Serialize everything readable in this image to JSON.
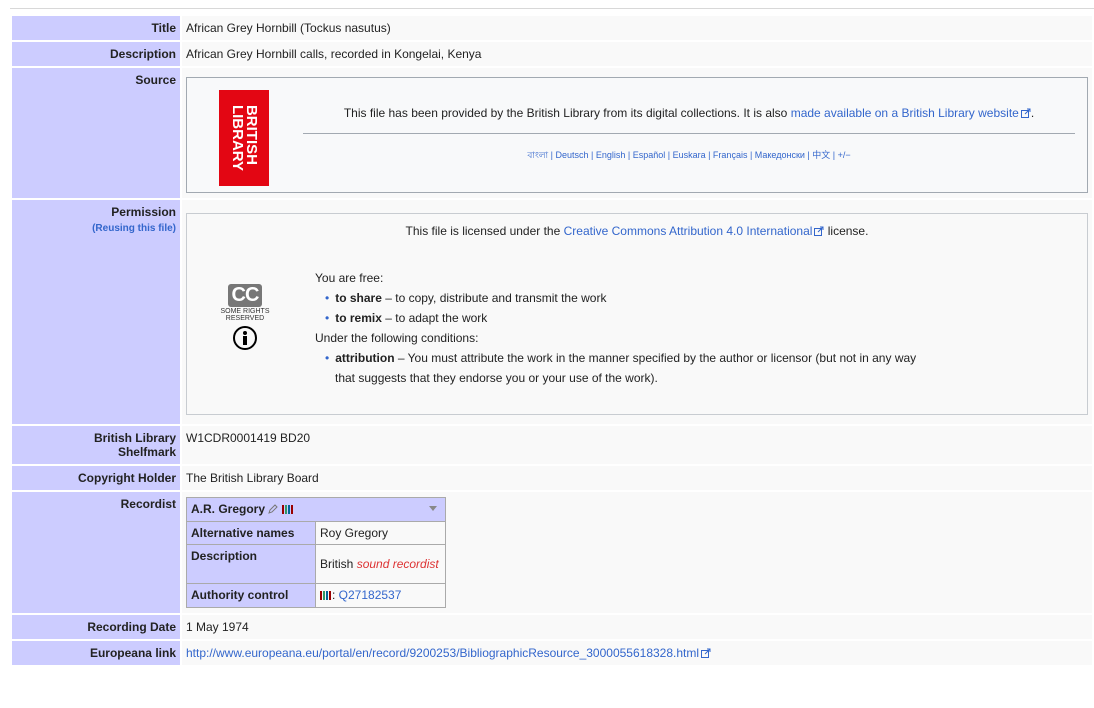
{
  "rows": {
    "title": {
      "label": "Title",
      "value": "African Grey Hornbill (Tockus nasutus)"
    },
    "description": {
      "label": "Description",
      "value": "African Grey Hornbill calls, recorded in Kongelai, Kenya"
    },
    "source": {
      "label": "Source",
      "logo_text": "BRITISH\nLIBRARY",
      "text": "This file has been provided by the British Library from its digital collections. It is also ",
      "link": "made available on a British Library website",
      "text_end": ".",
      "languages": "বাংলা | Deutsch | English | Español | Euskara | Français | Македонски | 中文 | +/−"
    },
    "permission": {
      "label": "Permission",
      "reuse_link": "(Reusing this file)",
      "license_pre": "This file is licensed under the ",
      "license_link": "Creative Commons Attribution 4.0 International",
      "license_post": " license.",
      "cc_badge": "CC",
      "cc_sub": "SOME RIGHTS RESERVED",
      "you_are_free": "You are free:",
      "share_term": "to share",
      "share_desc": " – to copy, distribute and transmit the work",
      "remix_term": "to remix",
      "remix_desc": " – to adapt the work",
      "conditions": "Under the following conditions:",
      "attr_term": "attribution",
      "attr_desc": " – You must attribute the work in the manner specified by the author or licensor (but not in any way",
      "attr_desc2": "that suggests that they endorse you or your use of the work)."
    },
    "shelfmark": {
      "label1": "British Library",
      "label2": "Shelfmark",
      "value": "W1CDR0001419 BD20"
    },
    "copyright": {
      "label": "Copyright Holder",
      "value": "The British Library Board"
    },
    "recordist": {
      "label": "Recordist",
      "name": "A.R. Gregory",
      "alt_label": "Alternative names",
      "alt_value": "Roy Gregory",
      "desc_label": "Description",
      "desc_plain": "British ",
      "desc_red": "sound recordist",
      "auth_label": "Authority control",
      "auth_value": "Q27182537"
    },
    "recording_date": {
      "label": "Recording Date",
      "value": "1 May 1974"
    },
    "europeana": {
      "label": "Europeana link",
      "value": "http://www.europeana.eu/portal/en/record/9200253/BibliographicResource_3000055618328.html"
    }
  },
  "colors": {
    "label_bg": "#ccccff",
    "link": "#3366cc",
    "bl_red": "#e30613",
    "red_link": "#dd3333"
  },
  "icons": [
    "external-link-icon",
    "pencil-icon",
    "wikidata-icon",
    "cc-logo-icon",
    "cc-by-icon",
    "chevron-down-icon"
  ]
}
